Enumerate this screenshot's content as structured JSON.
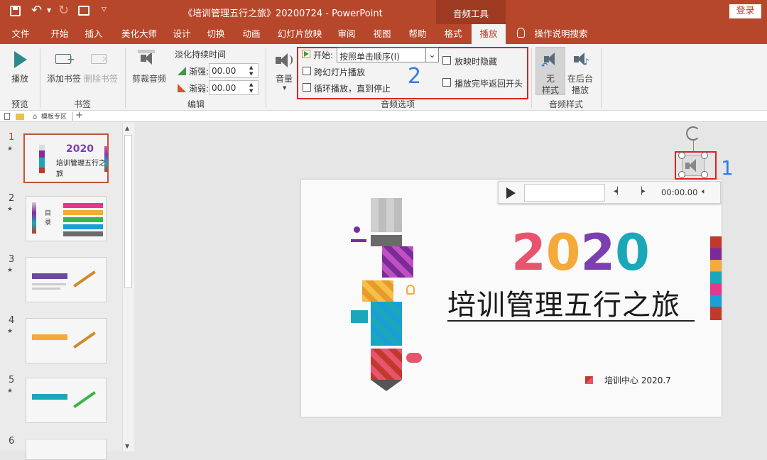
{
  "titlebar": {
    "title": "《培训管理五行之旅》20200724  -  PowerPoint",
    "context_tab": "音频工具",
    "login": "登录"
  },
  "tabs": [
    "文件",
    "开始",
    "插入",
    "美化大师",
    "设计",
    "切换",
    "动画",
    "幻灯片放映",
    "审阅",
    "视图",
    "帮助",
    "格式",
    "播放"
  ],
  "search_hint": "操作说明搜索",
  "ribbon": {
    "play_label": "播放",
    "add_bookmark": "添加书签",
    "remove_bookmark": "删除书签",
    "trim_audio": "剪裁音频",
    "fade_title": "淡化持续时间",
    "fade_in_label": "渐强:",
    "fade_in_value": "00.00",
    "fade_out_label": "渐弱:",
    "fade_out_value": "00.00",
    "volume": "音量",
    "start_label": "开始:",
    "start_value": "按照单击顺序(I)",
    "cross_slides": "跨幻灯片播放",
    "loop": "循环播放，直到停止",
    "hide": "放映时隐藏",
    "rewind": "播放完毕返回开头",
    "no_style_1": "无",
    "no_style_2": "样式",
    "bg_play_1": "在后台",
    "bg_play_2": "播放",
    "groups": {
      "preview": "预览",
      "bookmark": "书签",
      "edit": "编辑",
      "audio_options": "音频选项",
      "audio_style": "音频样式"
    }
  },
  "strip": {
    "tab_label": "模板专区"
  },
  "annotations": {
    "a1": "1",
    "a2": "2"
  },
  "thumbnails": [
    "1",
    "2",
    "3",
    "4",
    "5",
    "6"
  ],
  "player": {
    "time": "00:00.00"
  },
  "slide": {
    "year": "2020",
    "title": "培训管理五行之旅",
    "footer": "培训中心  2020.7"
  },
  "thumb_texts": {
    "t1_year": "2020",
    "t1_title": "培训管理五行之旅",
    "t2_mulu": "目录"
  },
  "colors": {
    "brand": "#b7472a",
    "annotation_red": "#e02020",
    "annotation_blue": "#2f7fe0",
    "year_pink": "#e8536e",
    "year_orange": "#f4a93a",
    "year_purple": "#7b3fb0",
    "year_teal": "#1aa8b8"
  }
}
